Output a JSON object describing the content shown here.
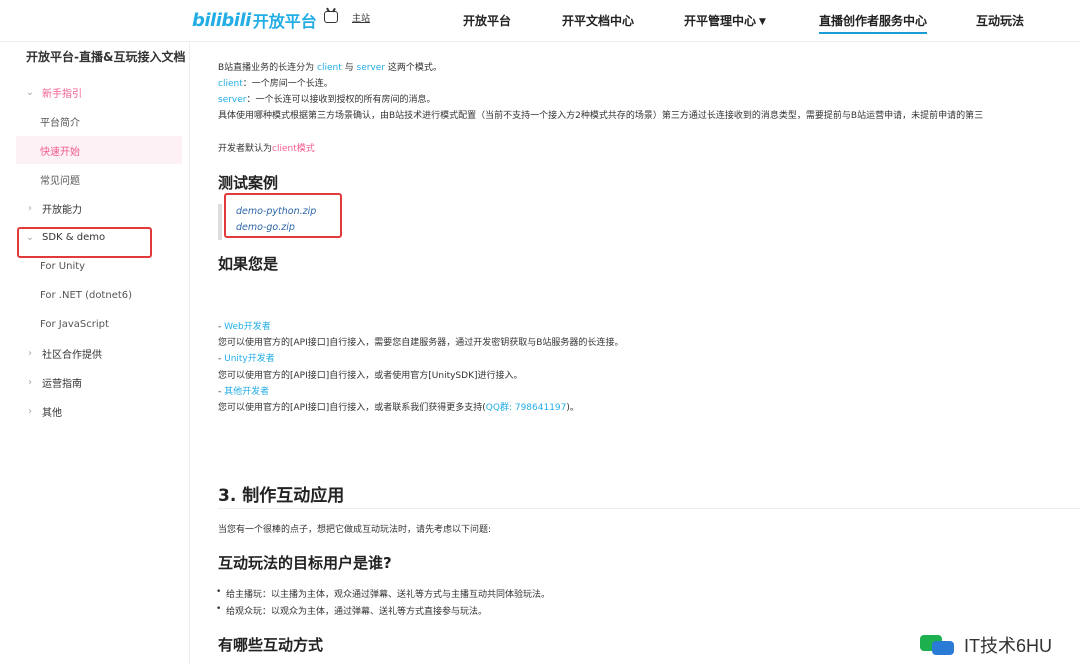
{
  "header": {
    "logo_mark": "bilibili",
    "logo_text": "开放平台",
    "home_label": "主站",
    "nav": [
      {
        "label": "开放平台",
        "has_caret": false,
        "active": false
      },
      {
        "label": "开平文档中心",
        "has_caret": false,
        "active": false
      },
      {
        "label": "开平管理中心",
        "has_caret": true,
        "active": false
      },
      {
        "label": "直播创作者服务中心",
        "has_caret": false,
        "active": true
      },
      {
        "label": "互动玩法",
        "has_caret": false,
        "active": false
      }
    ]
  },
  "sidebar": {
    "title": "开放平台-直播&互玩接入文档",
    "items": [
      {
        "label": "新手指引",
        "icon": "chevron-down-icon",
        "state": "open"
      },
      {
        "label": "平台简介",
        "icon": "",
        "state": "child"
      },
      {
        "label": "快速开始",
        "icon": "",
        "state": "selected"
      },
      {
        "label": "常见问题",
        "icon": "",
        "state": "child"
      },
      {
        "label": "开放能力",
        "icon": "chevron-right-icon",
        "state": "collapsed"
      },
      {
        "label": "SDK & demo",
        "icon": "chevron-down-icon",
        "state": "expanded"
      },
      {
        "label": "For Unity",
        "icon": "",
        "state": "child"
      },
      {
        "label": "For .NET (dotnet6)",
        "icon": "",
        "state": "child"
      },
      {
        "label": "For JavaScript",
        "icon": "",
        "state": "child"
      },
      {
        "label": "社区合作提供",
        "icon": "chevron-right-icon",
        "state": "collapsed"
      },
      {
        "label": "运营指南",
        "icon": "chevron-right-icon",
        "state": "collapsed"
      },
      {
        "label": "其他",
        "icon": "chevron-right-icon",
        "state": "collapsed"
      }
    ]
  },
  "content": {
    "intro_1a": "B站直播业务的长连分为 ",
    "intro_1b": "client",
    "intro_1c": " 与 ",
    "intro_1d": "server",
    "intro_1e": " 这两个模式。",
    "client_key": "client",
    "client_desc": "：一个房间一个长连。",
    "server_key": "server",
    "server_desc": "：一个长连可以接收到授权的所有房间的消息。",
    "detail": "具体使用哪种模式根据第三方场景确认，由B站技术进行模式配置（当前不支持一个接入方2种模式共存的场景）第三方通过长连接收到的消息类型，需要提前与B站运营申请，未提前申请的第三",
    "default_a": "开发者默认为",
    "default_b": "client模式",
    "test_heading": "测试案例",
    "zip_1": "demo-python.zip",
    "zip_2": "demo-go.zip",
    "if_heading": "如果您是",
    "web_dash": "- ",
    "web_link": "Web开发者",
    "web_desc": "您可以使用官方的[API接口]自行接入，需要您自建服务器，通过开发密钥获取与B站服务器的长连接。",
    "unity_dash": "- ",
    "unity_link": "Unity开发者",
    "unity_desc": "您可以使用官方的[API接口]自行接入，或者使用官方[UnitySDK]进行接入。",
    "other_dash": "- ",
    "other_link": "其他开发者",
    "other_desc_a": "您可以使用官方的[API接口]自行接入，或者联系我们获得更多支持(",
    "other_desc_b": "QQ群: 798641197",
    "other_desc_c": ")。",
    "section3": "3. 制作互动应用",
    "section3_intro": "当您有一个很棒的点子，想把它做成互动玩法时，请先考虑以下问题:",
    "target_heading": "互动玩法的目标用户是谁?",
    "bullet_1": "给主播玩：以主播为主体，观众通过弹幕、送礼等方式与主播互动共同体验玩法。",
    "bullet_2": "给观众玩：以观众为主体，通过弹幕、送礼等方式直接参与玩法。",
    "methods_heading": "有哪些互动方式"
  },
  "watermark": {
    "text": "IT技术6HU"
  },
  "colors": {
    "brand": "#23ade5",
    "accent_pink": "#f25d8e",
    "highlight_box": "#e03a3a"
  }
}
